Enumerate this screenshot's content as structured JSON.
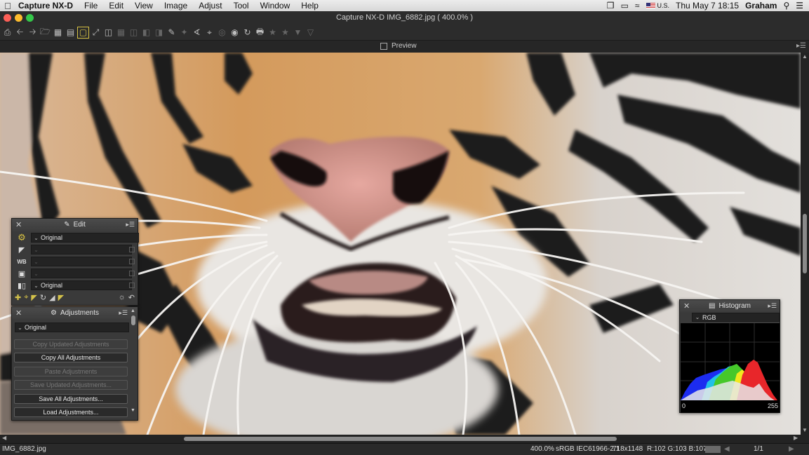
{
  "menubar": {
    "apple_icon": "apple-icon",
    "app_name": "Capture NX-D",
    "menus": [
      "File",
      "Edit",
      "View",
      "Image",
      "Adjust",
      "Tool",
      "Window",
      "Help"
    ],
    "input_source": "U.S.",
    "clock": "Thu May 7  18:15",
    "user": "Graham"
  },
  "window": {
    "title": "Capture NX-D     IMG_6882.jpg ( 400.0% )",
    "traffic_lights": {
      "close": "#fc5f57",
      "minimize": "#fdbc2e",
      "zoom": "#34c84a"
    }
  },
  "toolbar": {
    "icons": [
      "print-icon",
      "back-icon",
      "forward-icon",
      "open-folder-icon",
      "thumbnail-grid-icon",
      "filmstrip-icon",
      "single-view-icon",
      "full-screen-icon",
      "compare-two-icon",
      "compare-four-icon",
      "compare-side-icon",
      "compare-multi-icon",
      "before-after-icon",
      "color-picker-icon",
      "auto-retouch-icon",
      "straighten-icon",
      "crop-icon",
      "control-point-icon",
      "red-eye-icon",
      "rotate-icon",
      "display-icon",
      "rating-icon",
      "star-icon",
      "filter-icon",
      "filter-settings-icon"
    ]
  },
  "preview": {
    "label": "Preview",
    "checked": false
  },
  "edit_panel": {
    "title": "Edit",
    "rows": [
      {
        "icon": "gear-icon",
        "value": "Original"
      },
      {
        "icon": "exposure-icon",
        "value": ""
      },
      {
        "icon": "white-balance-icon",
        "value": ""
      },
      {
        "icon": "picture-control-icon",
        "value": ""
      },
      {
        "icon": "version-icon",
        "value": "Original"
      }
    ]
  },
  "adjustments_panel": {
    "title": "Adjustments",
    "selected": "Original",
    "buttons": [
      {
        "label": "Copy Updated Adjustments",
        "enabled": false
      },
      {
        "label": "Copy All Adjustments",
        "enabled": true
      },
      {
        "label": "Paste Adjustments",
        "enabled": false
      },
      {
        "label": "Save Updated Adjustments...",
        "enabled": false
      },
      {
        "label": "Save All Adjustments...",
        "enabled": true
      },
      {
        "label": "Load Adjustments...",
        "enabled": true
      }
    ]
  },
  "histogram_panel": {
    "title": "Histogram",
    "channel": "RGB",
    "axis_min": "0",
    "axis_max": "255",
    "colors": {
      "red": "#e8262a",
      "green": "#46c82a",
      "blue": "#1c2cf0",
      "yellow": "#f2e81e",
      "cyan": "#22c0e8",
      "white": "#e8e8e8"
    }
  },
  "status": {
    "filename": "IMG_6882.jpg",
    "zoom": "400.0%",
    "color_space": "sRGB IEC61966-2.1",
    "dimensions": "718x1148",
    "pixel_rgb": "R:102 G:103 B:107",
    "page": "1/1"
  }
}
